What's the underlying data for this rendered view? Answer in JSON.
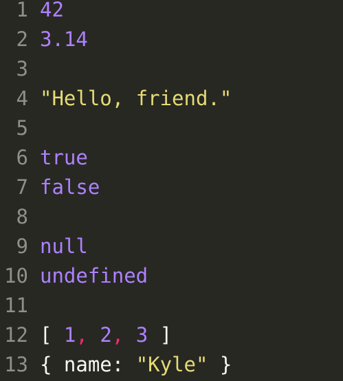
{
  "colors": {
    "background": "#272822",
    "gutter_text": "#8f908a",
    "default_text": "#f8f8f2",
    "number": "#ae81ff",
    "string": "#e6db74",
    "keyword": "#ae81ff",
    "comma": "#f92672"
  },
  "lines": [
    {
      "num": "1",
      "tokens": [
        {
          "t": "42",
          "type": "number"
        }
      ]
    },
    {
      "num": "2",
      "tokens": [
        {
          "t": "3.14",
          "type": "number"
        }
      ]
    },
    {
      "num": "3",
      "tokens": []
    },
    {
      "num": "4",
      "tokens": [
        {
          "t": "\"Hello, friend.\"",
          "type": "string"
        }
      ]
    },
    {
      "num": "5",
      "tokens": []
    },
    {
      "num": "6",
      "tokens": [
        {
          "t": "true",
          "type": "keyword"
        }
      ]
    },
    {
      "num": "7",
      "tokens": [
        {
          "t": "false",
          "type": "keyword"
        }
      ]
    },
    {
      "num": "8",
      "tokens": []
    },
    {
      "num": "9",
      "tokens": [
        {
          "t": "null",
          "type": "keyword"
        }
      ]
    },
    {
      "num": "10",
      "tokens": [
        {
          "t": "undefined",
          "type": "keyword"
        }
      ]
    },
    {
      "num": "11",
      "tokens": []
    },
    {
      "num": "12",
      "tokens": [
        {
          "t": "[ ",
          "type": "punct"
        },
        {
          "t": "1",
          "type": "number"
        },
        {
          "t": ",",
          "type": "comma"
        },
        {
          "t": " ",
          "type": "punct"
        },
        {
          "t": "2",
          "type": "number"
        },
        {
          "t": ",",
          "type": "comma"
        },
        {
          "t": " ",
          "type": "punct"
        },
        {
          "t": "3",
          "type": "number"
        },
        {
          "t": " ]",
          "type": "punct"
        }
      ]
    },
    {
      "num": "13",
      "tokens": [
        {
          "t": "{ ",
          "type": "punct"
        },
        {
          "t": "name",
          "type": "prop"
        },
        {
          "t": ": ",
          "type": "punct"
        },
        {
          "t": "\"Kyle\"",
          "type": "string"
        },
        {
          "t": " }",
          "type": "punct"
        }
      ]
    }
  ]
}
